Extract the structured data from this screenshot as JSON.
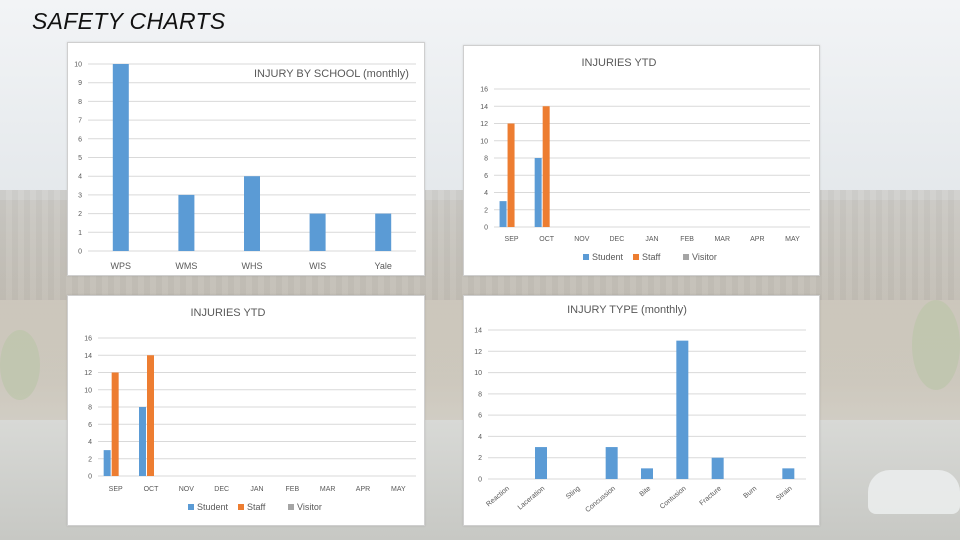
{
  "slide": {
    "title": "SAFETY CHARTS"
  },
  "colors": {
    "student": "#5b9bd5",
    "staff": "#ed7d31",
    "visitor": "#a5a5a5",
    "bar": "#5b9bd5"
  },
  "chart_data": [
    {
      "id": "school",
      "type": "bar",
      "title": "INJURY BY SCHOOL (monthly)",
      "categories": [
        "WPS",
        "WMS",
        "WHS",
        "WIS",
        "Yale"
      ],
      "values": [
        10,
        3,
        4,
        2,
        2
      ],
      "ylim": [
        0,
        10
      ],
      "yticks": [
        0,
        1,
        2,
        3,
        4,
        5,
        6,
        7,
        8,
        9,
        10
      ],
      "grid": true
    },
    {
      "id": "ytd1",
      "type": "bar",
      "title": "INJURIES  YTD",
      "categories": [
        "SEP",
        "OCT",
        "NOV",
        "DEC",
        "JAN",
        "FEB",
        "MAR",
        "APR",
        "MAY"
      ],
      "series": [
        {
          "name": "Student",
          "values": [
            3,
            8,
            0,
            0,
            0,
            0,
            0,
            0,
            0
          ]
        },
        {
          "name": "Staff",
          "values": [
            12,
            14,
            0,
            0,
            0,
            0,
            0,
            0,
            0
          ]
        },
        {
          "name": "Visitor",
          "values": [
            0,
            0,
            0,
            0,
            0,
            0,
            0,
            0,
            0
          ]
        }
      ],
      "ylim": [
        0,
        16
      ],
      "yticks": [
        0,
        2,
        4,
        6,
        8,
        10,
        12,
        14,
        16
      ],
      "grid": true,
      "legend": "bottom"
    },
    {
      "id": "ytd2",
      "type": "bar",
      "title": "INJURIES  YTD",
      "categories": [
        "SEP",
        "OCT",
        "NOV",
        "DEC",
        "JAN",
        "FEB",
        "MAR",
        "APR",
        "MAY"
      ],
      "series": [
        {
          "name": "Student",
          "values": [
            3,
            8,
            0,
            0,
            0,
            0,
            0,
            0,
            0
          ]
        },
        {
          "name": "Staff",
          "values": [
            12,
            14,
            0,
            0,
            0,
            0,
            0,
            0,
            0
          ]
        },
        {
          "name": "Visitor",
          "values": [
            0,
            0,
            0,
            0,
            0,
            0,
            0,
            0,
            0
          ]
        }
      ],
      "ylim": [
        0,
        16
      ],
      "yticks": [
        0,
        2,
        4,
        6,
        8,
        10,
        12,
        14,
        16
      ],
      "grid": true,
      "legend": "bottom"
    },
    {
      "id": "type",
      "type": "bar",
      "title": "INJURY TYPE (monthly)",
      "categories": [
        "Reaction",
        "Laceration",
        "Sting",
        "Concussion",
        "Bite",
        "Contusion",
        "Fracture",
        "Burn",
        "Strain"
      ],
      "values": [
        0,
        3,
        0,
        3,
        1,
        13,
        2,
        0,
        1
      ],
      "ylim": [
        0,
        14
      ],
      "yticks": [
        0,
        2,
        4,
        6,
        8,
        10,
        12,
        14
      ],
      "grid": true
    }
  ]
}
